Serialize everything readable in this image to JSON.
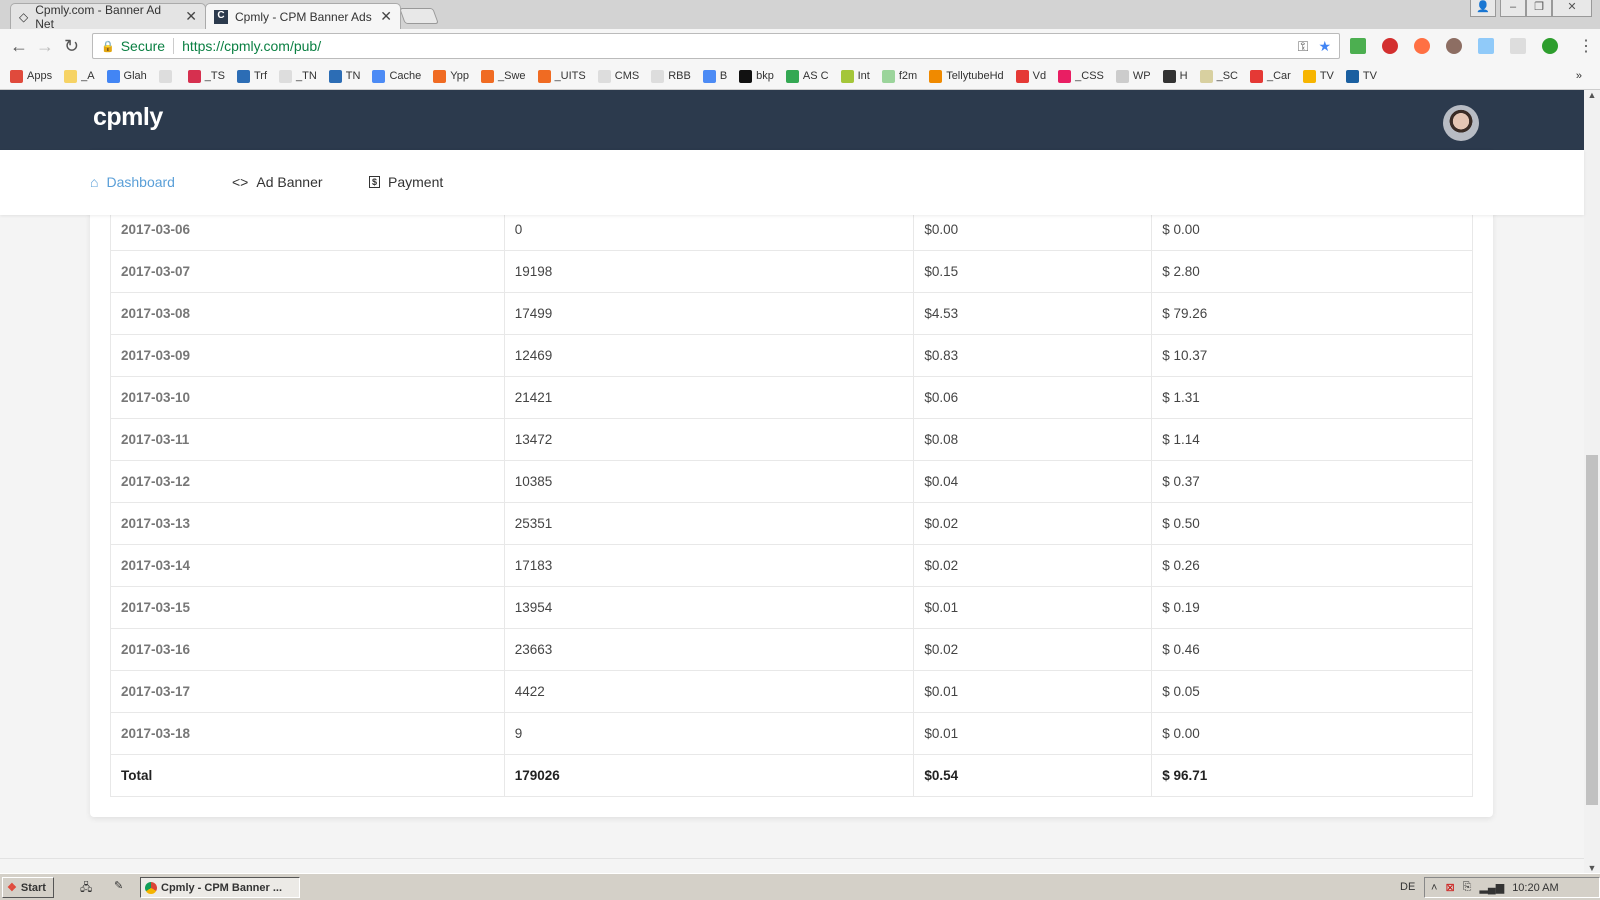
{
  "browser": {
    "tabs": [
      {
        "title": "Cpmly.com - Banner Ad Net",
        "close": "✕"
      },
      {
        "title": "Cpmly - CPM Banner Ads",
        "close": "✕"
      }
    ],
    "secure_label": "Secure",
    "url": "https://cpmly.com/pub/",
    "bookmarks": [
      {
        "label": "Apps",
        "color": "#e04a3c"
      },
      {
        "label": "_A",
        "color": "#f6d365"
      },
      {
        "label": "Glah",
        "color": "#4285f4"
      },
      {
        "label": "",
        "color": "#ddd"
      },
      {
        "label": "_TS",
        "color": "#d6304f"
      },
      {
        "label": "Trf",
        "color": "#2c6db5"
      },
      {
        "label": "_TN",
        "color": "#ddd"
      },
      {
        "label": "TN",
        "color": "#2c6db5"
      },
      {
        "label": "Cache",
        "color": "#4c8bf5"
      },
      {
        "label": "Ypp",
        "color": "#f06b22"
      },
      {
        "label": "_Swe",
        "color": "#f06b22"
      },
      {
        "label": "_UITS",
        "color": "#f06b22"
      },
      {
        "label": "CMS",
        "color": "#ddd"
      },
      {
        "label": "RBB",
        "color": "#ddd"
      },
      {
        "label": "B",
        "color": "#4c8bf5"
      },
      {
        "label": "bkp",
        "color": "#111"
      },
      {
        "label": "AS C",
        "color": "#34a853"
      },
      {
        "label": "Int",
        "color": "#a4c639"
      },
      {
        "label": "f2m",
        "color": "#9bd49b"
      },
      {
        "label": "TellytubeHd",
        "color": "#f08a00"
      },
      {
        "label": "Vd",
        "color": "#e53935"
      },
      {
        "label": "_CSS",
        "color": "#e91e63"
      },
      {
        "label": "WP",
        "color": "#ccc"
      },
      {
        "label": "H",
        "color": "#333"
      },
      {
        "label": "_SC",
        "color": "#d8d0a0"
      },
      {
        "label": "_Car",
        "color": "#e53935"
      },
      {
        "label": "TV",
        "color": "#f7b500"
      },
      {
        "label": "TV",
        "color": "#1a5fa0"
      }
    ],
    "more": "»"
  },
  "app": {
    "logo": "cpmly",
    "nav": [
      {
        "label": "Dashboard",
        "icon": "home-icon"
      },
      {
        "label": "Ad Banner",
        "icon": "code-icon"
      },
      {
        "label": "Payment",
        "icon": "dollar-bill-icon"
      }
    ],
    "accent": "#5a9fd8",
    "header_bg": "#2c3a4d"
  },
  "table": {
    "rows": [
      [
        "2017-03-06",
        "0",
        "$0.00",
        "$ 0.00"
      ],
      [
        "2017-03-07",
        "19198",
        "$0.15",
        "$ 2.80"
      ],
      [
        "2017-03-08",
        "17499",
        "$4.53",
        "$ 79.26"
      ],
      [
        "2017-03-09",
        "12469",
        "$0.83",
        "$ 10.37"
      ],
      [
        "2017-03-10",
        "21421",
        "$0.06",
        "$ 1.31"
      ],
      [
        "2017-03-11",
        "13472",
        "$0.08",
        "$ 1.14"
      ],
      [
        "2017-03-12",
        "10385",
        "$0.04",
        "$ 0.37"
      ],
      [
        "2017-03-13",
        "25351",
        "$0.02",
        "$ 0.50"
      ],
      [
        "2017-03-14",
        "17183",
        "$0.02",
        "$ 0.26"
      ],
      [
        "2017-03-15",
        "13954",
        "$0.01",
        "$ 0.19"
      ],
      [
        "2017-03-16",
        "23663",
        "$0.02",
        "$ 0.46"
      ],
      [
        "2017-03-17",
        "4422",
        "$0.01",
        "$ 0.05"
      ],
      [
        "2017-03-18",
        "9",
        "$0.01",
        "$ 0.00"
      ]
    ],
    "total": [
      "Total",
      "179026",
      "$0.54",
      "$ 96.71"
    ]
  },
  "taskbar": {
    "start": "Start",
    "task": "Cpmly - CPM Banner ...",
    "lang": "DE",
    "clock": "10:20 AM"
  }
}
